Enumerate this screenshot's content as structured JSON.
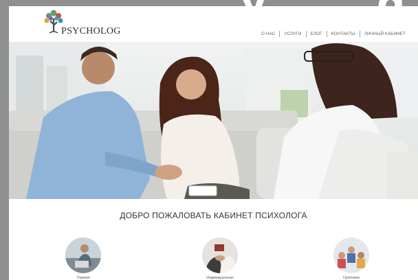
{
  "background_title_fragment": "y  g",
  "brand": {
    "name": "PSYCHOLOG"
  },
  "nav": {
    "items": [
      "О НАС",
      "УСЛУГИ",
      "БЛОГ",
      "КОНТАКТЫ",
      "ЛИЧНЫЙ КАБИНЕТ"
    ]
  },
  "hero": {
    "image": "counseling-session-photo"
  },
  "welcome": {
    "title": "ДОБРО ПОЖАЛОВАТЬ КАБИНЕТ ПСИХОЛОГА"
  },
  "services": [
    {
      "label": "Терапия"
    },
    {
      "label": "Индивидуальная"
    },
    {
      "label": "Групповая"
    }
  ],
  "colors": {
    "page_bg": "#8f8f8f",
    "content_bg": "#ffffff",
    "nav_text": "#666666",
    "heading": "#333333"
  }
}
